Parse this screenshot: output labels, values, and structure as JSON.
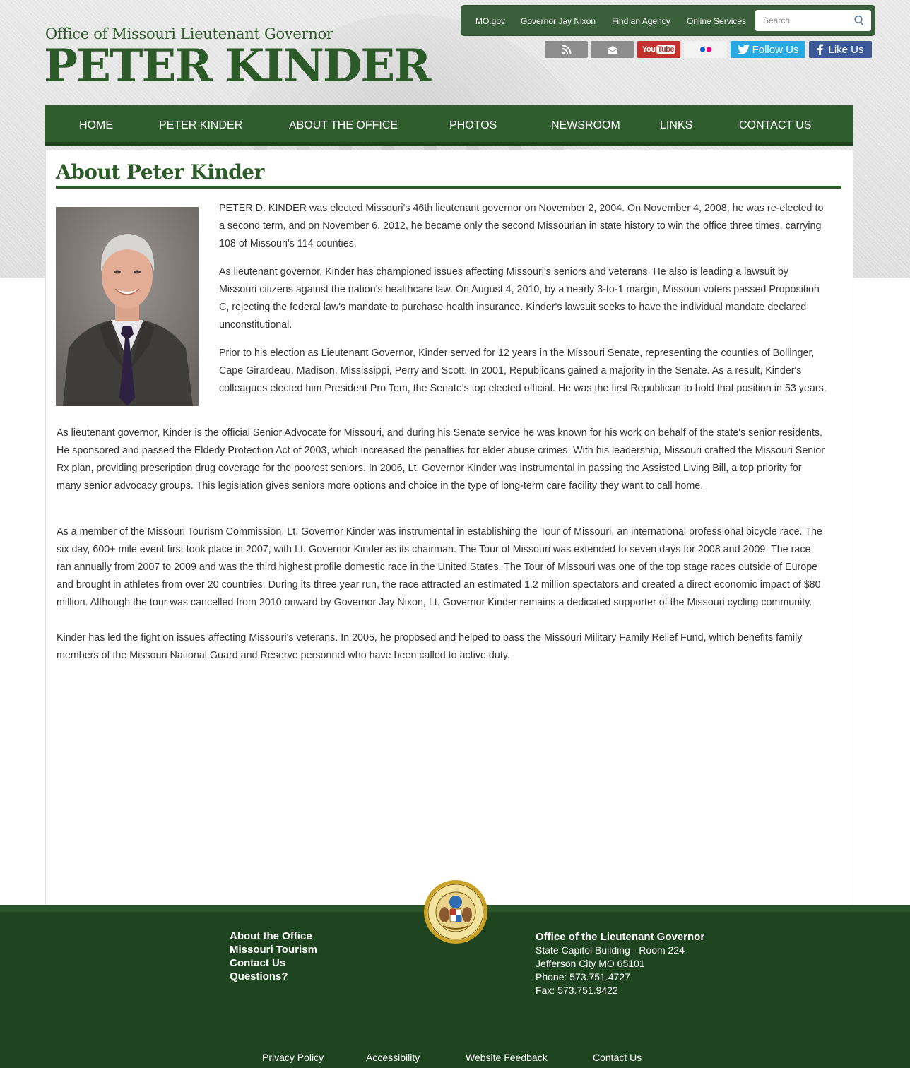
{
  "header": {
    "office_line": "Office of Missouri Lieutenant Governor",
    "name_line": "PETER KINDER"
  },
  "utility_nav": {
    "items": [
      "MO.gov",
      "Governor Jay Nixon",
      "Find an Agency",
      "Online Services"
    ],
    "search_placeholder": "Search"
  },
  "social": {
    "rss_icon": "rss-icon",
    "email_icon": "email-icon",
    "youtube": {
      "you": "You",
      "tube": "Tube"
    },
    "flickr_icon": "flickr-icon",
    "twitter_label": "Follow Us",
    "facebook_label": "Like Us",
    "colors": {
      "twitter": "#2aa9e0",
      "facebook": "#3b5998",
      "youtube": "#c4302b",
      "grey": "#8e8e8e"
    }
  },
  "main_nav": {
    "items": [
      "HOME",
      "PETER KINDER",
      "ABOUT THE OFFICE",
      "PHOTOS",
      "NEWSROOM",
      "LINKS",
      "CONTACT US"
    ]
  },
  "content": {
    "title": "About Peter Kinder",
    "paragraphs": [
      "PETER D. KINDER was elected Missouri's 46th lieutenant governor on November 2, 2004. On November 4, 2008, he was re-elected to a second term, and on November 6, 2012, he became only the second Missourian in state history to win the office three times, carrying 108 of Missouri's 114 counties.",
      "As lieutenant governor, Kinder has championed issues affecting Missouri's seniors and veterans. He also is leading a lawsuit by Missouri citizens against the nation's healthcare law. On August 4, 2010, by a nearly 3-to-1 margin, Missouri voters passed Proposition C, rejecting the federal law's mandate to purchase health insurance. Kinder's lawsuit seeks to have the individual mandate declared unconstitutional.",
      "Prior to his election as Lieutenant Governor, Kinder served for 12 years in the Missouri Senate, representing the counties of Bollinger, Cape Girardeau, Madison, Mississippi, Perry and Scott. In 2001, Republicans gained a majority in the Senate. As a result, Kinder's colleagues elected him President Pro Tem, the Senate's top elected official. He was the first Republican to hold that position in 53 years.",
      "As lieutenant governor, Kinder is the official Senior Advocate for Missouri, and during his Senate service he was known for his work on behalf of the state's senior residents. He sponsored and passed the Elderly Protection Act of 2003, which increased the penalties for elder abuse crimes. With his leadership, Missouri crafted the Missouri Senior Rx plan, providing prescription drug coverage for the poorest seniors. In 2006, Lt. Governor Kinder was instrumental in passing the Assisted Living Bill, a top priority for many senior advocacy groups. This legislation gives seniors more options and choice in the type of long-term care facility they want to call home.",
      "As a member of the Missouri Tourism Commission, Lt. Governor Kinder was instrumental in establishing the Tour of Missouri, an international professional bicycle race. The six day, 600+ mile event first took place in 2007, with Lt. Governor Kinder as its chairman. The Tour of Missouri was extended to seven days for 2008 and 2009. The race ran annually from 2007 to 2009 and was the third highest profile domestic race in the United States. The Tour of Missouri was one of the top stage races outside of Europe and brought in athletes from over 20 countries. During its three year run, the race attracted an estimated 1.2 million spectators and created a direct economic impact of $80 million. Although the tour was cancelled from 2010 onward by Governor Jay Nixon, Lt. Governor Kinder remains a dedicated supporter of the Missouri cycling community.",
      "Kinder has led the fight on issues affecting Missouri's veterans. In 2005, he proposed and helped to pass the Missouri Military Family Relief Fund, which benefits family members of the Missouri National Guard and Reserve personnel who have been called to active duty."
    ]
  },
  "footer": {
    "links": [
      "About the Office",
      "Missouri Tourism",
      "Contact Us",
      "Questions?"
    ],
    "address": {
      "title": "Office of the Lieutenant Governor",
      "line1": "State Capitol Building - Room 224",
      "line2": "Jefferson City MO 65101",
      "phone": "Phone: 573.751.4727",
      "fax": "Fax: 573.751.9422"
    },
    "bottom_links": [
      "Privacy Policy",
      "Accessibility",
      "Website Feedback",
      "Contact Us"
    ],
    "seal_icon": "missouri-state-seal-icon"
  }
}
